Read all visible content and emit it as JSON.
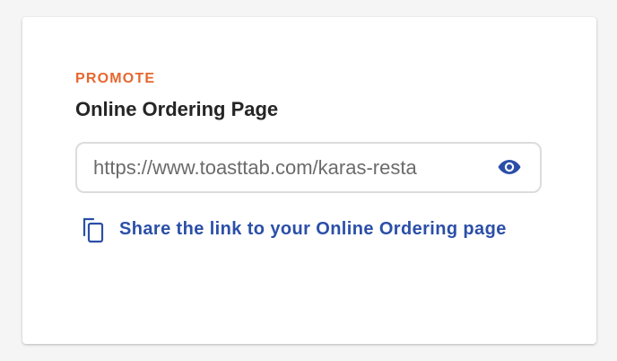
{
  "card": {
    "eyebrow": "PROMOTE",
    "title": "Online Ordering Page",
    "url_field": {
      "value": "https://www.toasttab.com/karas-resta",
      "toggle_icon": "eye-icon"
    },
    "share": {
      "icon": "copy-icon",
      "label": "Share the link to your Online Ordering page"
    }
  },
  "colors": {
    "accent": "#e5672f",
    "link": "#2b4fa8",
    "title": "#252525"
  }
}
